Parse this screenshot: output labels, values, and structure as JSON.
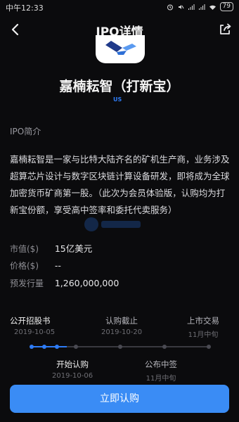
{
  "status_bar": {
    "time": "中午12:33",
    "icons": [
      "alarm-icon",
      "mute-icon",
      "signal-icon",
      "signal-icon",
      "wifi-icon"
    ],
    "battery": "79"
  },
  "nav": {
    "title": "IPO详情",
    "back_icon": "chevron-left-icon",
    "share_icon": "share-icon"
  },
  "company": {
    "name": "嘉楠耘智（打新宝）",
    "market": "US"
  },
  "intro": {
    "section_title": "IPO简介",
    "text": "嘉楠耘智是一家与比特大陆齐名的矿机生产商，业务涉及超算芯片设计与数字区块链计算设备研发，即将成为全球加密货币矿商第一股。（此次为会员体验版，认购均为打新宝份额，享受高中签率和委托代卖服务）"
  },
  "details": [
    {
      "label": "市值($)",
      "value": "15亿美元"
    },
    {
      "label": "价格($)",
      "value": "--"
    },
    {
      "label": "预发行量",
      "value": "1,260,000,000"
    }
  ],
  "timeline": {
    "top": [
      {
        "label": "公开招股书",
        "date": "2019-10-05"
      },
      {
        "label": "认购截止",
        "date": "2019-10-20"
      },
      {
        "label": "上市交易",
        "date": "11月中旬"
      }
    ],
    "bottom": [
      {
        "label": "开始认购",
        "date": "2019-10-06"
      },
      {
        "label": "公布中签",
        "date": "11月中旬"
      }
    ],
    "progress": 0.2
  },
  "subscribe_button": "立即认购",
  "colors": {
    "accent": "#2e7cf6",
    "button": "#3a8cf5",
    "background": "#0b0b0d"
  }
}
